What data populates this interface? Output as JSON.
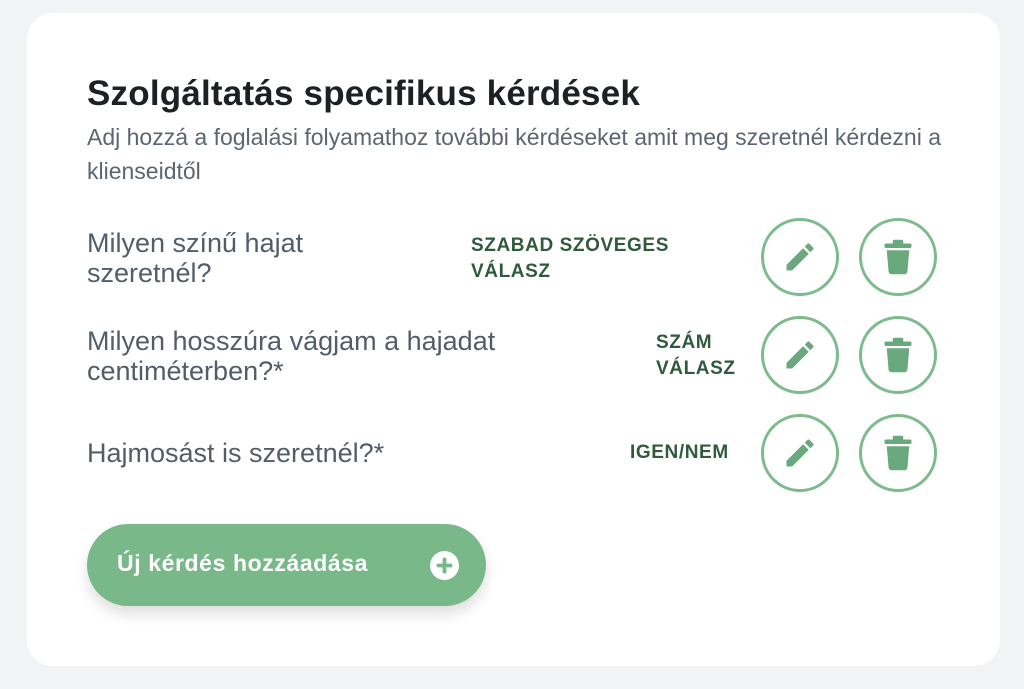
{
  "section": {
    "title": "Szolgáltatás specifikus kérdések",
    "subtitle": "Adj hozzá a foglalási folyamathoz további kérdéseket amit meg szeretnél kérdezni a klienseidtől"
  },
  "questions": [
    {
      "text": "Milyen színű hajat szeretnél?",
      "answer_type": "SZABAD SZÖVEGES VÁLASZ"
    },
    {
      "text": "Milyen hosszúra vágjam a hajadat centiméterben?*",
      "answer_type": "SZÁM VÁLASZ"
    },
    {
      "text": "Hajmosást is szeretnél?*",
      "answer_type": "IGEN/NEM"
    }
  ],
  "icons": {
    "edit": "pencil-icon",
    "delete": "trash-icon",
    "add": "plus-circle-icon"
  },
  "add_button": {
    "label": "Új kérdés hozzáadása"
  },
  "colors": {
    "accent": "#78b889",
    "accent_border": "#7dbb8e",
    "icon": "#6aa97d",
    "label_dark_green": "#2f5a3d"
  }
}
